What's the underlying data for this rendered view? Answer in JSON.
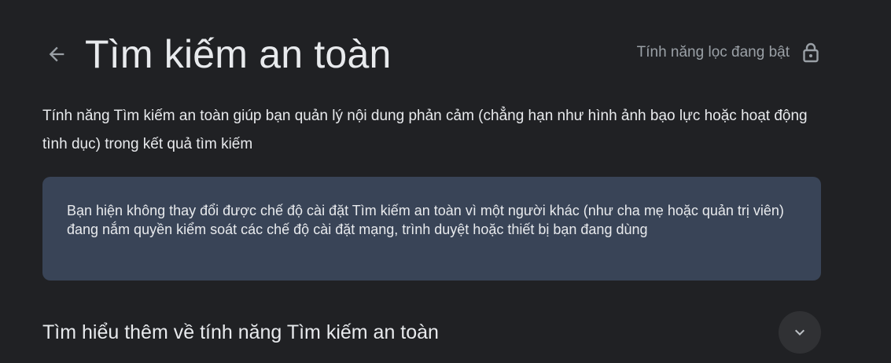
{
  "header": {
    "title": "Tìm kiếm an toàn",
    "back_icon": "arrow-left-icon",
    "filter_status": "Tính năng lọc đang bật",
    "lock_icon": "lock-icon"
  },
  "description": "Tính năng Tìm kiếm an toàn giúp bạn quản lý nội dung phản cảm (chẳng hạn như hình ảnh bạo lực hoặc hoạt động tình dục) trong kết quả tìm kiếm",
  "notice": {
    "text": "Bạn hiện không thay đổi được chế độ cài đặt Tìm kiếm an toàn vì một người khác (như cha mẹ hoặc quản trị viên) đang nắm quyền kiểm soát các chế độ cài đặt mạng, trình duyệt hoặc thiết bị bạn đang dùng",
    "background": "#394457"
  },
  "learn_more": {
    "label": "Tìm hiểu thêm về tính năng Tìm kiếm an toàn",
    "expand_icon": "chevron-down-icon"
  },
  "colors": {
    "background": "#202124",
    "text": "#e8eaed",
    "muted_text": "#9aa0a6"
  }
}
